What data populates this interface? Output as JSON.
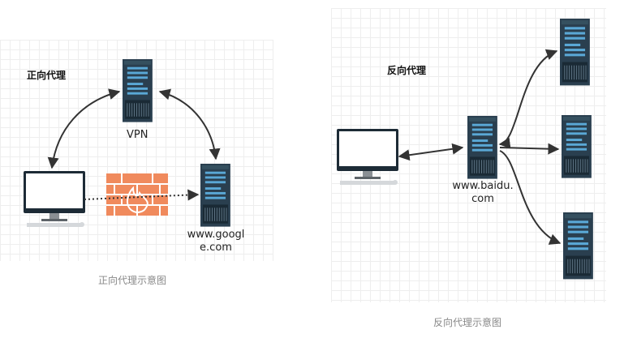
{
  "forward": {
    "title": "正向代理",
    "vpn_label": "VPN",
    "target_label_line1": "www.googl",
    "target_label_line2": "e.com",
    "caption": "正向代理示意图"
  },
  "reverse": {
    "title": "反向代理",
    "proxy_label_line1": "www.baidu.",
    "proxy_label_line2": "com",
    "caption": "反向代理示意图"
  },
  "colors": {
    "server_body": "#2a3f4f",
    "server_stripe": "#5aa8d6",
    "firewall": "#f08a5d",
    "arrow": "#333333"
  }
}
